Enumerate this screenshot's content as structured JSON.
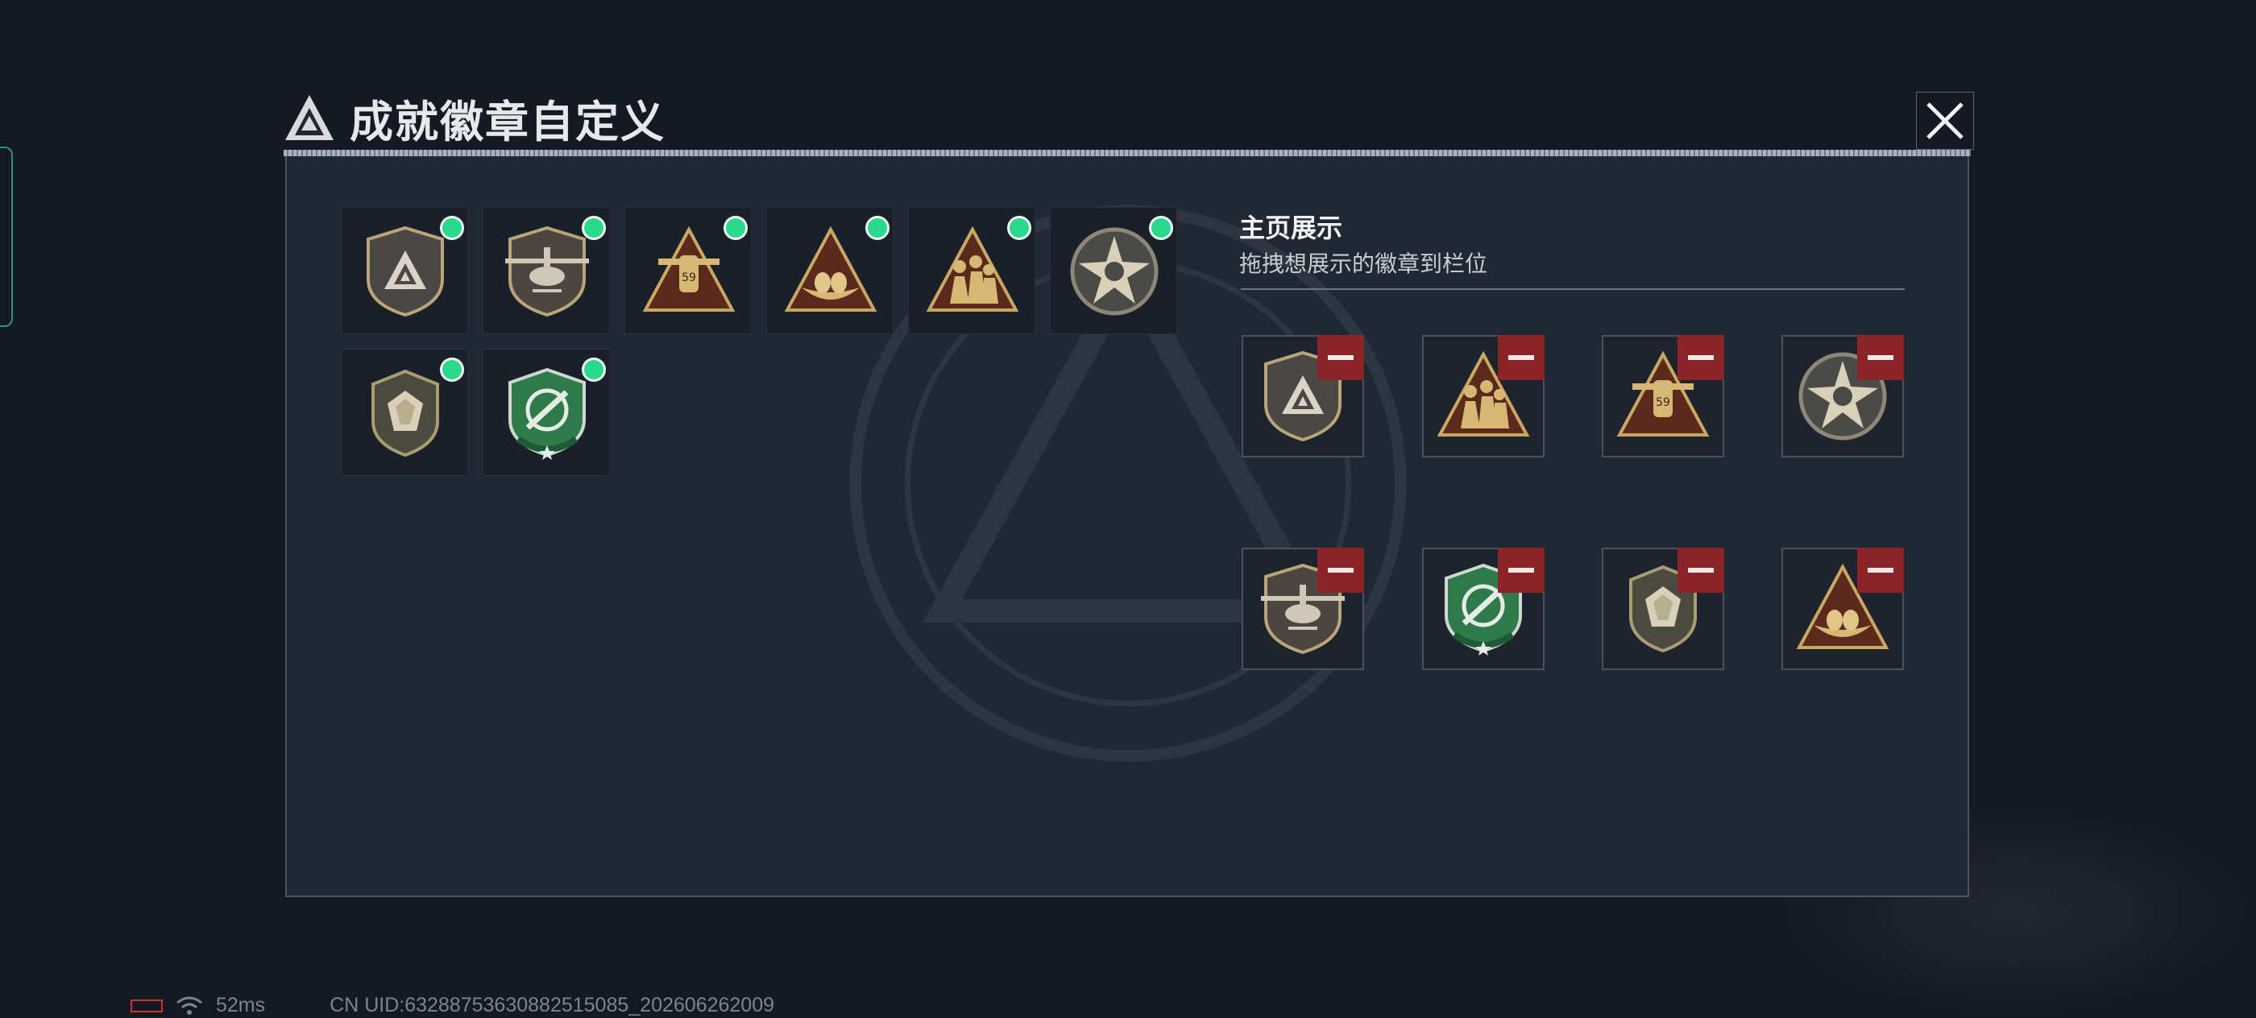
{
  "header": {
    "title": "成就徽章自定义",
    "close_icon": "close-icon"
  },
  "owned_badges": [
    {
      "id": "shield-triangle",
      "icon": "shield-triangle-badge",
      "equipped": true
    },
    {
      "id": "helicopter",
      "icon": "helicopter-badge",
      "equipped": true
    },
    {
      "id": "plane-59",
      "icon": "plane-59-badge",
      "equipped": true
    },
    {
      "id": "nest",
      "icon": "nest-badge",
      "equipped": true
    },
    {
      "id": "soldiers",
      "icon": "soldiers-badge",
      "equipped": true
    },
    {
      "id": "skull-star",
      "icon": "skull-star-badge",
      "equipped": true
    },
    {
      "id": "gem-shield",
      "icon": "gem-shield-badge",
      "equipped": true
    },
    {
      "id": "green-crosshair",
      "icon": "green-crosshair-badge",
      "equipped": true
    }
  ],
  "showcase": {
    "title": "主页展示",
    "subtitle": "拖拽想展示的徽章到栏位",
    "slots": [
      {
        "badge": "shield-triangle",
        "remove_icon": "minus-icon"
      },
      {
        "badge": "soldiers",
        "remove_icon": "minus-icon"
      },
      {
        "badge": "plane-59",
        "remove_icon": "minus-icon"
      },
      {
        "badge": "skull-star",
        "remove_icon": "minus-icon"
      },
      {
        "badge": "helicopter",
        "remove_icon": "minus-icon"
      },
      {
        "badge": "green-crosshair",
        "remove_icon": "minus-icon"
      },
      {
        "badge": "gem-shield",
        "remove_icon": "minus-icon"
      },
      {
        "badge": "nest",
        "remove_icon": "minus-icon"
      }
    ]
  },
  "status_bar": {
    "ping": "52ms",
    "uid": "CN UID:632887536308825150​85_202606262009"
  },
  "colors": {
    "equipped_dot": "#2ad98a",
    "remove_button": "#8a2429",
    "badge_gold": "#c8a862"
  }
}
